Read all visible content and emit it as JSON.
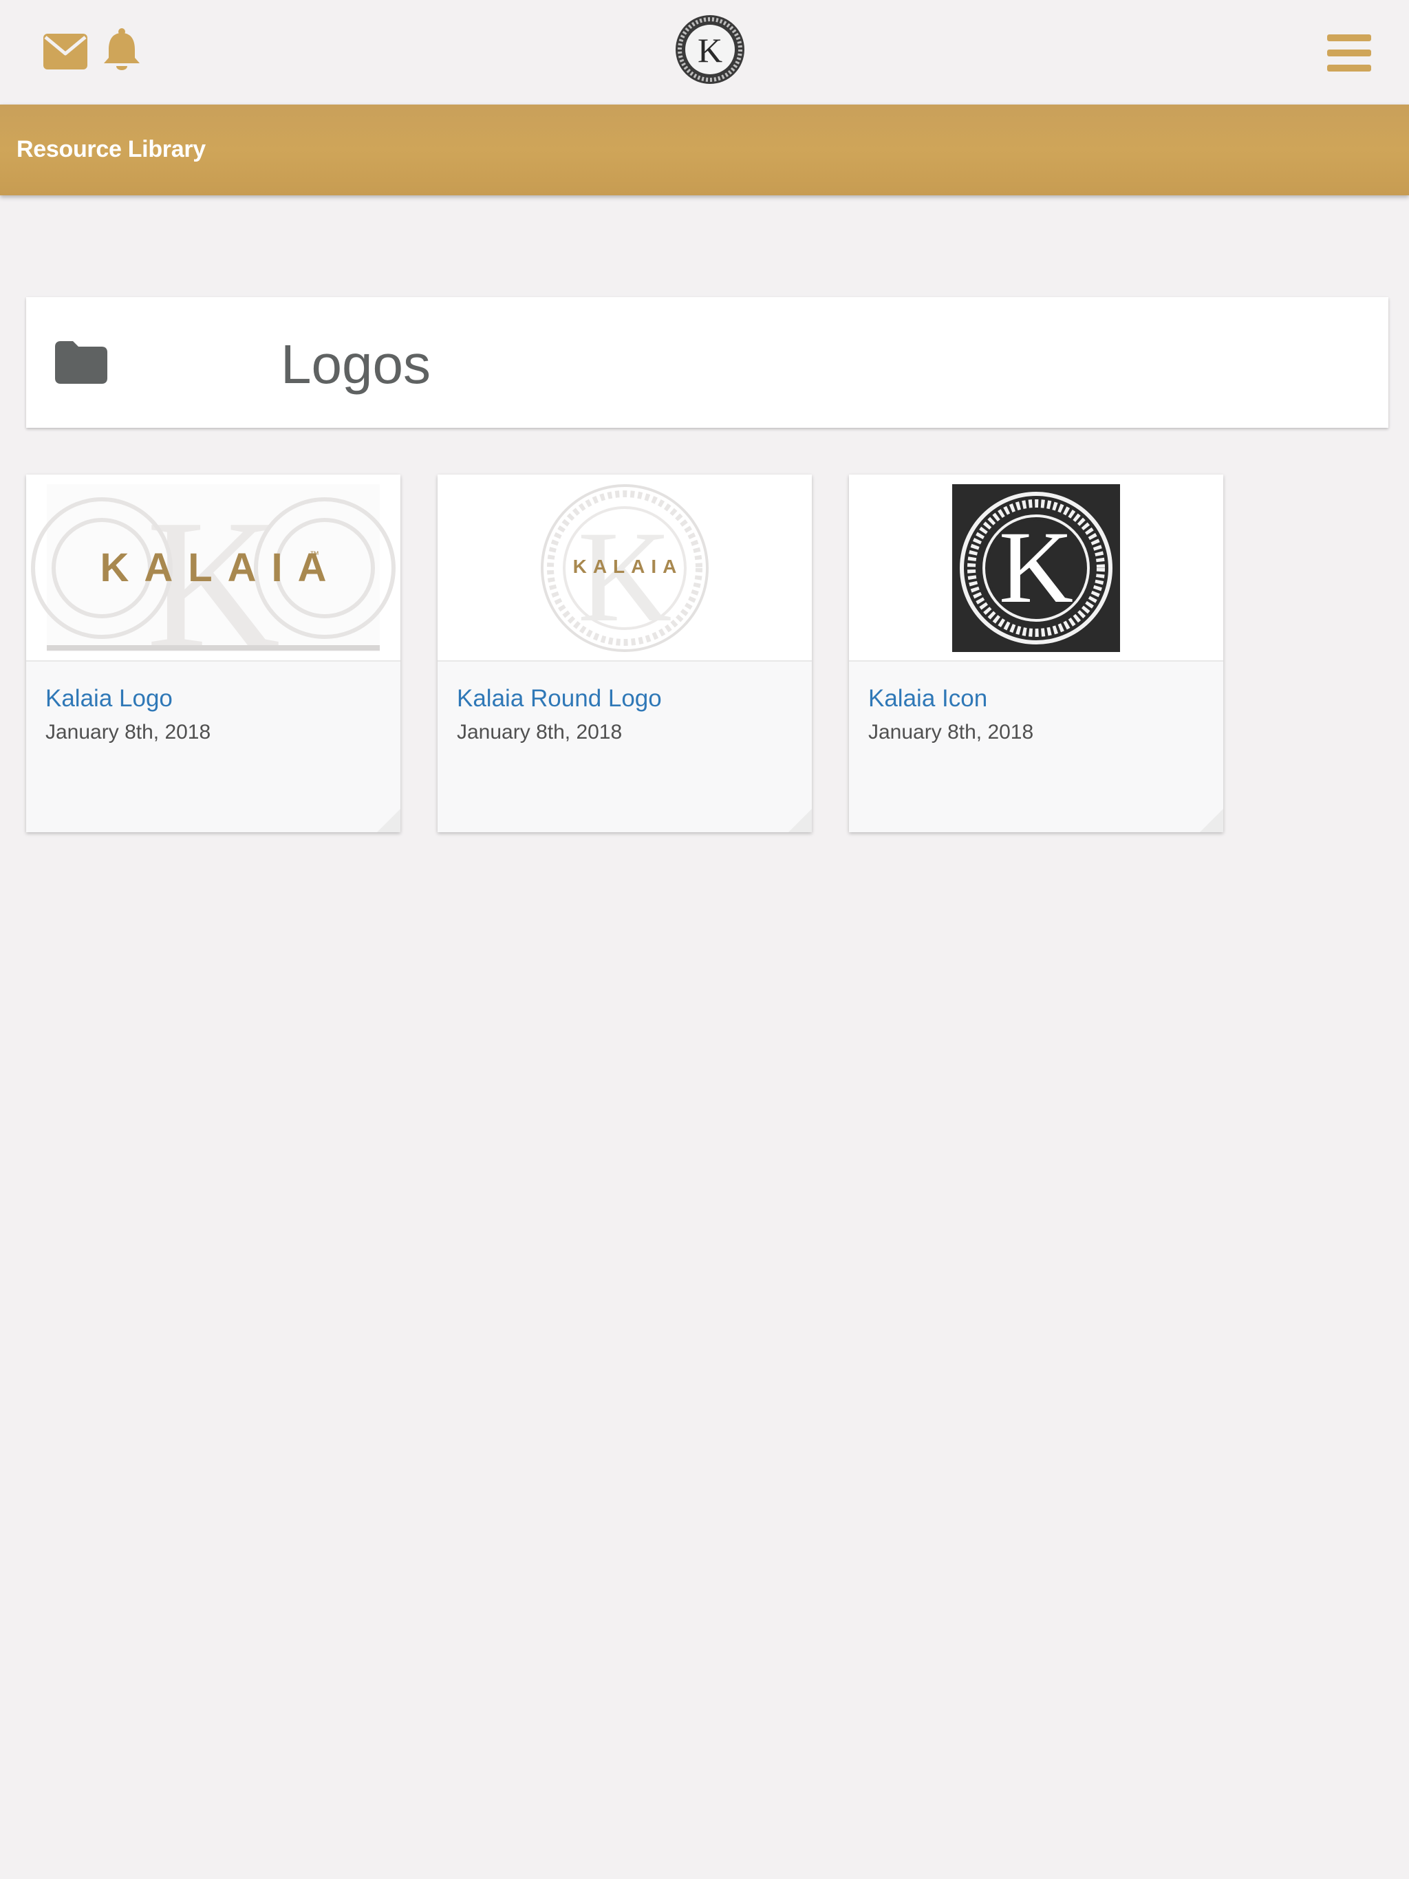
{
  "header": {
    "mail_icon": "envelope-icon",
    "notifications_icon": "bell-icon",
    "brand_icon": "kalaia-k-emblem",
    "menu_icon": "hamburger-icon",
    "section_title": "Resource Library"
  },
  "colors": {
    "gold": "#cfa559",
    "link_blue": "#2f78b7",
    "folder_gray": "#5f6262",
    "background": "#f3f1f2"
  },
  "folder": {
    "icon": "folder-icon",
    "name": "Logos"
  },
  "resources": [
    {
      "title": "Kalaia Logo",
      "date": "January 8th, 2018",
      "thumb_text": "KALAIA",
      "thumb_trademark": "™"
    },
    {
      "title": "Kalaia Round Logo",
      "date": "January 8th, 2018",
      "thumb_text": "KALAIA"
    },
    {
      "title": "Kalaia Icon",
      "date": "January 8th, 2018",
      "thumb_text": "K"
    }
  ]
}
